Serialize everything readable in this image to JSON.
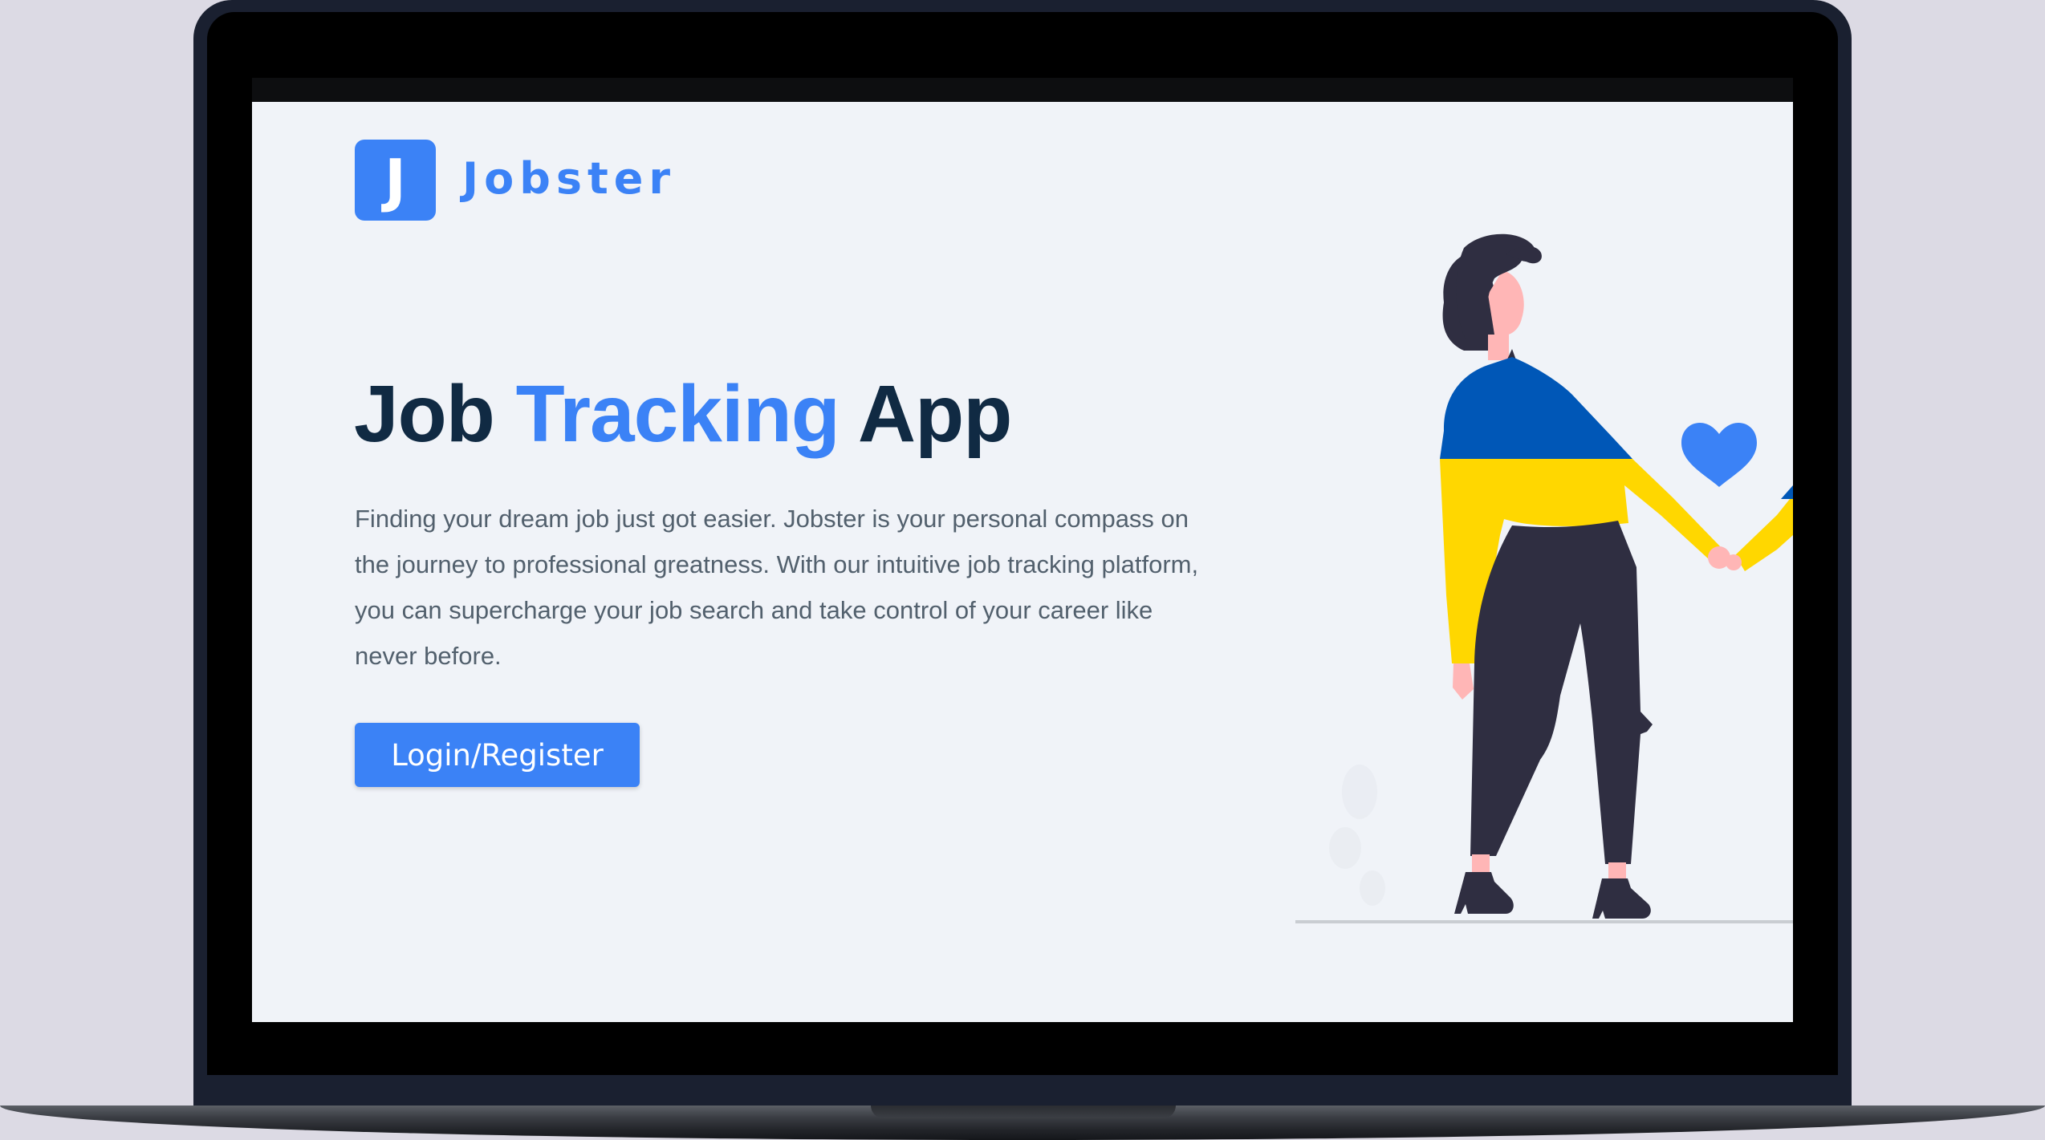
{
  "brand": {
    "logo_letter": "J",
    "name": "Jobster"
  },
  "hero": {
    "title_part1": "Job ",
    "title_accent": "Tracking",
    "title_part2": " App",
    "description": "Finding your dream job just got easier. Jobster is your personal compass on the journey to professional greatness. With our intuitive job tracking platform, you can supercharge your job search and take control of your career like never before.",
    "cta_label": "Login/Register"
  },
  "colors": {
    "primary": "#3b82f6",
    "heading": "#102a43",
    "text": "#52606d",
    "background": "#f0f3f8",
    "flag_blue": "#0057b7",
    "flag_yellow": "#ffd700"
  },
  "illustration": {
    "icon": "heart-icon"
  }
}
